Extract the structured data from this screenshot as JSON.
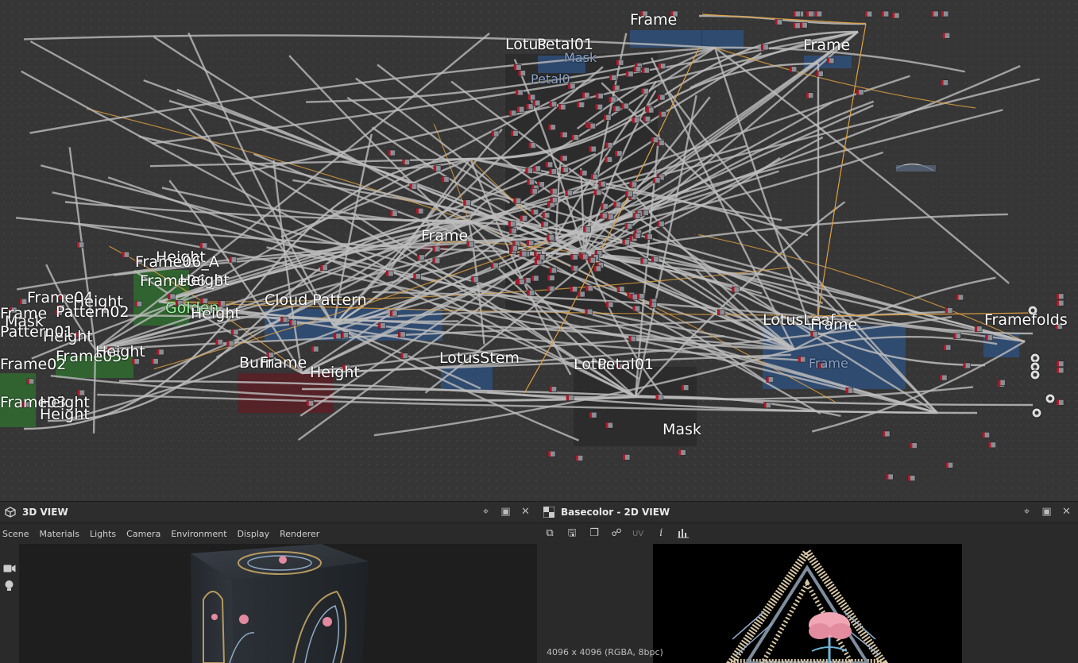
{
  "graph": {
    "frame_labels": [
      {
        "text": "Frame",
        "cls": ""
      },
      {
        "text": "Frame",
        "cls": ""
      },
      {
        "text": "Lotus",
        "cls": ""
      },
      {
        "text": "Petal01",
        "cls": ""
      },
      {
        "text": "Mask",
        "cls": "dim"
      },
      {
        "text": "Petal0",
        "cls": "dim"
      },
      {
        "text": "Frame",
        "cls": ""
      },
      {
        "text": "Cloud Pattern",
        "cls": ""
      },
      {
        "text": "LotusStem",
        "cls": ""
      },
      {
        "text": "Lotus",
        "cls": ""
      },
      {
        "text": "Petal01",
        "cls": ""
      },
      {
        "text": "Mask",
        "cls": ""
      },
      {
        "text": "LotusLeaf",
        "cls": ""
      },
      {
        "text": "Frame",
        "cls": ""
      },
      {
        "text": "Frame",
        "cls": "dim"
      },
      {
        "text": "Framefolds",
        "cls": ""
      },
      {
        "text": "Burn",
        "cls": ""
      },
      {
        "text": "Frame",
        "cls": ""
      },
      {
        "text": "Height",
        "cls": ""
      },
      {
        "text": "Height",
        "cls": ""
      },
      {
        "text": "Frame06_A",
        "cls": ""
      },
      {
        "text": "Frame06_B",
        "cls": ""
      },
      {
        "text": "Height",
        "cls": ""
      },
      {
        "text": "Golden",
        "cls": "green"
      },
      {
        "text": "Height",
        "cls": ""
      },
      {
        "text": "Frame04",
        "cls": ""
      },
      {
        "text": "Height",
        "cls": ""
      },
      {
        "text": "Pattern02",
        "cls": ""
      },
      {
        "text": "Frame05",
        "cls": ""
      },
      {
        "text": "Height",
        "cls": ""
      },
      {
        "text": "Height",
        "cls": ""
      },
      {
        "text": "Frame02",
        "cls": ""
      },
      {
        "text": "Frame03",
        "cls": ""
      },
      {
        "text": "Height",
        "cls": ""
      },
      {
        "text": "Pattern01",
        "cls": ""
      },
      {
        "text": "Mask",
        "cls": ""
      },
      {
        "text": "Frame",
        "cls": ""
      },
      {
        "text": "Height",
        "cls": ""
      }
    ]
  },
  "view3d": {
    "title": "3D VIEW",
    "menu": [
      "Scene",
      "Materials",
      "Lights",
      "Camera",
      "Environment",
      "Display",
      "Renderer"
    ]
  },
  "view2d": {
    "title": "Basecolor - 2D VIEW",
    "uv_label": "UV",
    "resolution": "4096 x 4096 (RGBA, 8bpc)"
  },
  "colors": {
    "graph_bg": "#363636",
    "frame_blue": "#2f4f7a",
    "frame_dark": "#2a2a2a",
    "frame_green": "#2f6b2f",
    "frame_red": "#5a1e26",
    "link": "#bdbdbd",
    "link_orange": "#e0a040",
    "node_red": "#b01a2a"
  }
}
